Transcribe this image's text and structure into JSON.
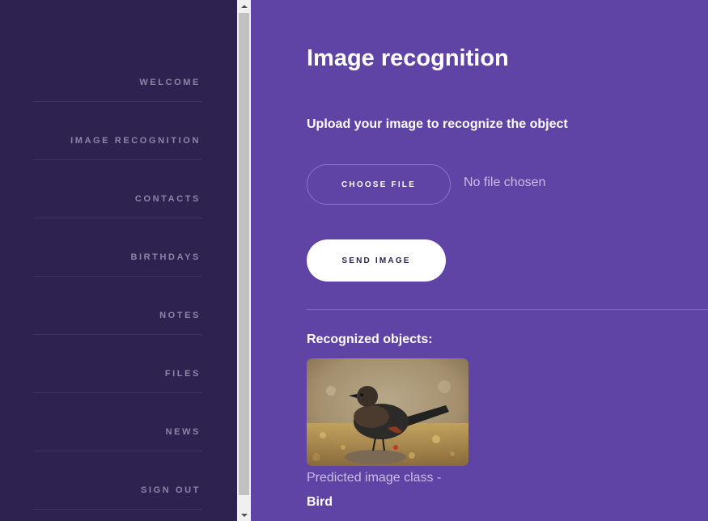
{
  "sidebar": {
    "items": [
      {
        "label": "WELCOME"
      },
      {
        "label": "IMAGE RECOGNITION"
      },
      {
        "label": "CONTACTS"
      },
      {
        "label": "BIRTHDAYS"
      },
      {
        "label": "NOTES"
      },
      {
        "label": "FILES"
      },
      {
        "label": "NEWS"
      },
      {
        "label": "SIGN OUT"
      }
    ]
  },
  "main": {
    "title": "Image recognition",
    "upload_label": "Upload your image to recognize the object",
    "choose_file_label": "CHOOSE FILE",
    "file_status": "No file chosen",
    "send_label": "SEND IMAGE",
    "recognized_label": "Recognized objects:",
    "predicted_label": "Predicted image class -",
    "predicted_class": "Bird"
  },
  "colors": {
    "sidebar_bg": "#2e2350",
    "main_bg": "#5f43a5",
    "nav_text": "#8d84a8",
    "accent_white": "#ffffff"
  },
  "icons": {
    "scroll_up": "chevron-up-icon",
    "scroll_down": "chevron-down-icon"
  }
}
